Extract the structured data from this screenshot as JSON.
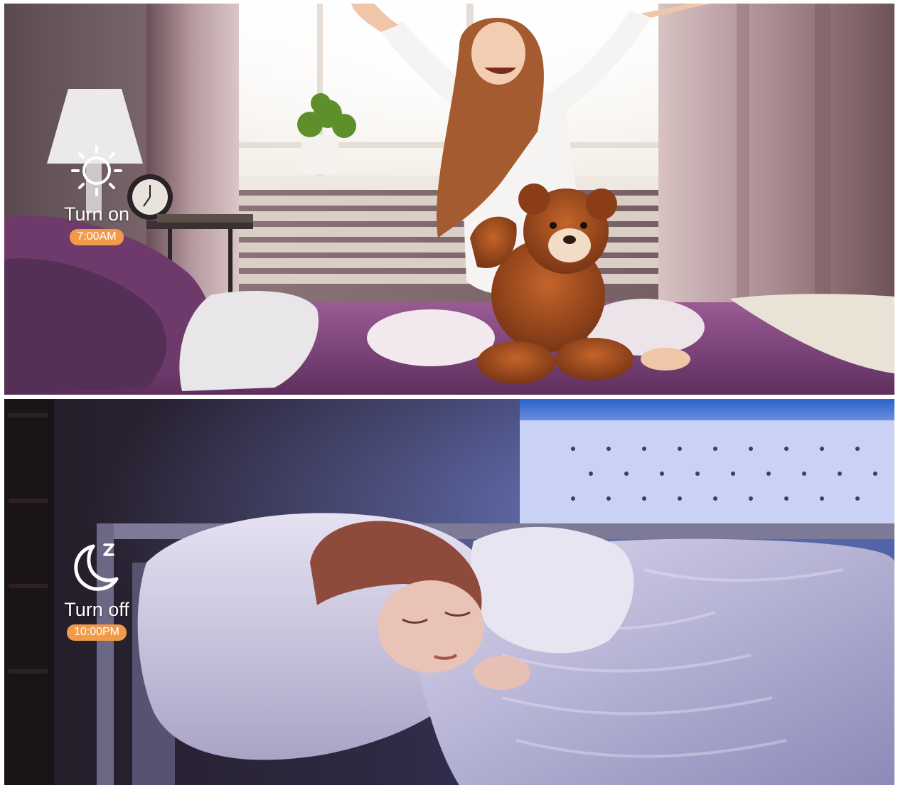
{
  "colors": {
    "badge": "#f29a4a",
    "overlay_text": "#ffffff",
    "day_bedspread": "#7b3f7a",
    "night_tint": "#4a4f9a"
  },
  "panels": [
    {
      "scene": "morning",
      "icon": "sun-icon",
      "label": "Turn on",
      "time": "7:00AM"
    },
    {
      "scene": "night",
      "icon": "moon-sleep-icon",
      "label": "Turn off",
      "time": "10:00PM"
    }
  ]
}
